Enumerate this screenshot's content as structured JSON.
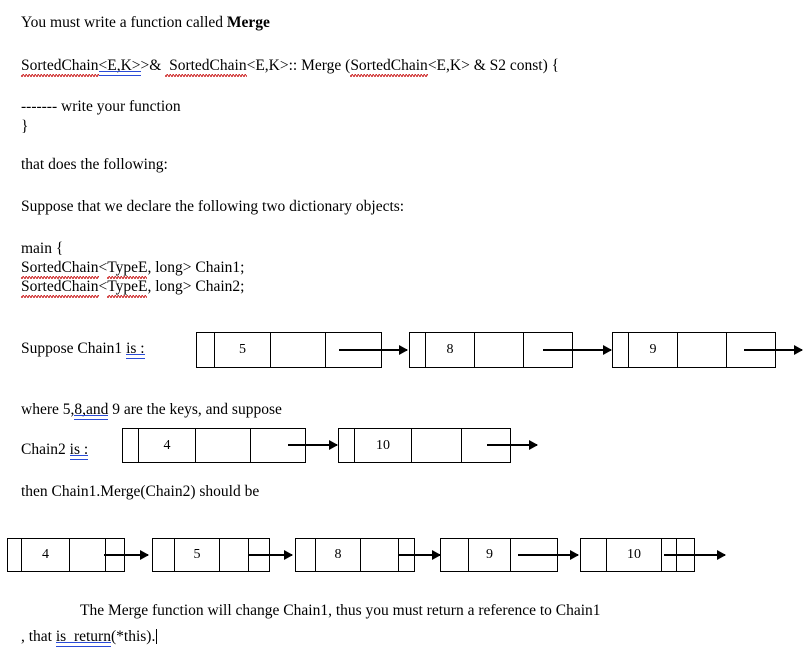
{
  "document": {
    "title": "Merge Function Assignment",
    "lines": {
      "l1_pre": "You must write a function called ",
      "l1_bold": "Merge",
      "l2_a": "SortedChain",
      "l2_b": "<E,K>",
      "l2_c": ">& ",
      "l2_d": " SortedChain",
      "l2_e": "<E,K>:: Merge (",
      "l2_f": "SortedChain",
      "l2_g": "<E,K> & S2 const) {",
      "l3": "------- write your function",
      "l4": "}",
      "l5": "that does the following:",
      "l6": "Suppose that we declare the following two dictionary objects:",
      "l7": "main {",
      "l8_a": "SortedChain",
      "l8_b": "<",
      "l8_c": "TypeE",
      "l8_d": ", long> Chain1;",
      "l9_a": "SortedChain",
      "l9_b": "<",
      "l9_c": "TypeE",
      "l9_d": ", long> Chain2;",
      "l10_a": "Suppose Chain1 ",
      "l10_b": "is :",
      "l11_a": "where 5,",
      "l11_b": "8,and",
      "l11_c": " 9 are the keys, and suppose",
      "l12_a": "Chain2 ",
      "l12_b": "is :",
      "l13": "then Chain1.Merge(Chain2) should be",
      "l14": "The Merge function will change Chain1, thus you must return a reference to Chain1",
      "l15_a": ", that ",
      "l15_b": "is  return",
      "l15_c": "(*this)."
    }
  },
  "diagrams": {
    "chain1": {
      "label": "Suppose Chain1 is :",
      "nodes": [
        {
          "key": "5"
        },
        {
          "key": "8"
        },
        {
          "key": "9"
        }
      ]
    },
    "chain2": {
      "label": "Chain2 is :",
      "nodes": [
        {
          "key": "4"
        },
        {
          "key": "10"
        }
      ]
    },
    "merged": {
      "label": "then Chain1.Merge(Chain2) should be",
      "nodes": [
        {
          "key": "4"
        },
        {
          "key": "5"
        },
        {
          "key": "8"
        },
        {
          "key": "9"
        },
        {
          "key": "10"
        }
      ]
    }
  },
  "colors": {
    "text": "#000000",
    "spellcheck_underline": "#cc2020",
    "grammar_underline": "#2a4bd7",
    "page_background": "#ffffff"
  }
}
